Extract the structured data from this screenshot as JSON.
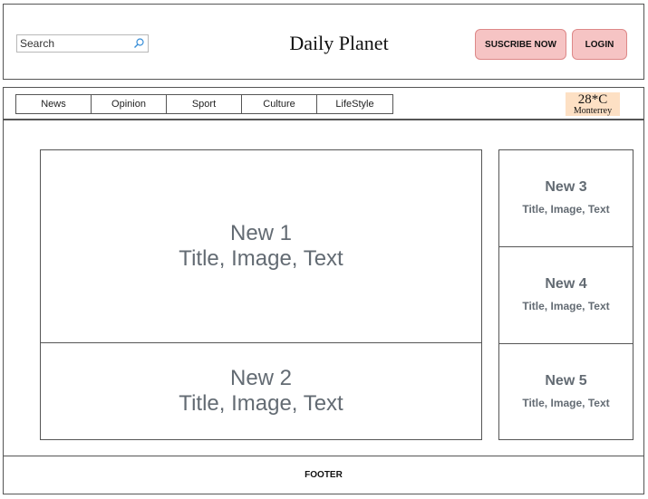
{
  "header": {
    "search_placeholder": "Search",
    "title": "Daily Planet",
    "subscribe_label": "SUSCRIBE NOW",
    "login_label": "LOGIN"
  },
  "nav": {
    "tabs": [
      "News",
      "Opinion",
      "Sport",
      "Culture",
      "LifeStyle"
    ]
  },
  "weather": {
    "temp": "28*C",
    "city": "Monterrey"
  },
  "news": [
    {
      "title": "New 1",
      "subtitle": "Title, Image, Text"
    },
    {
      "title": "New 2",
      "subtitle": "Title, Image, Text"
    },
    {
      "title": "New 3",
      "subtitle": "Title, Image, Text"
    },
    {
      "title": "New 4",
      "subtitle": "Title, Image, Text"
    },
    {
      "title": "New 5",
      "subtitle": "Title, Image, Text"
    }
  ],
  "footer": {
    "label": "FOOTER"
  },
  "colors": {
    "button_bg": "#f6c4c4",
    "weather_bg": "#fde0c4",
    "card_text": "#636b73"
  }
}
